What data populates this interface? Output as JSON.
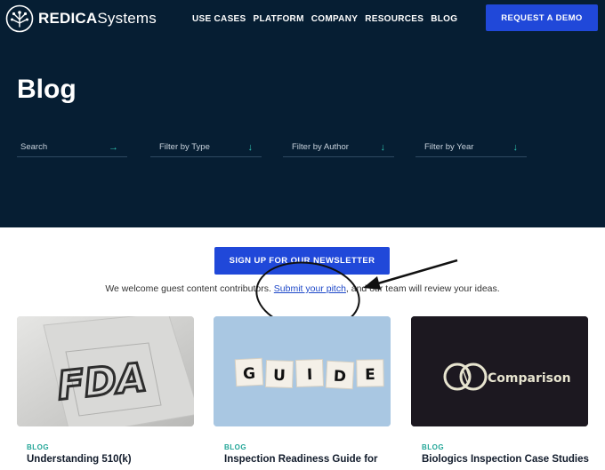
{
  "brand": {
    "name_bold": "REDICA",
    "name_regular": "Systems"
  },
  "nav": {
    "items": [
      "USE CASES",
      "PLATFORM",
      "COMPANY",
      "RESOURCES",
      "BLOG"
    ],
    "cta": "REQUEST A DEMO"
  },
  "hero": {
    "title": "Blog",
    "search_label": "Search",
    "filters": [
      "Filter by Type",
      "Filter by Author",
      "Filter by Year"
    ]
  },
  "newsletter": {
    "button": "SIGN UP FOR OUR NEWSLETTER",
    "text_before": "We welcome guest content contributors. ",
    "link": "Submit your pitch",
    "text_after": ", and our team will review your ideas."
  },
  "cards": [
    {
      "tag": "BLOG",
      "title": "Understanding 510(k)",
      "image_text": "FDA"
    },
    {
      "tag": "BLOG",
      "title": "Inspection Readiness Guide for",
      "image_text": [
        "G",
        "U",
        "I",
        "D",
        "E"
      ]
    },
    {
      "tag": "BLOG",
      "title": "Biologics Inspection Case Studies",
      "image_text": "Comparison"
    }
  ],
  "colors": {
    "hero_bg": "#061e33",
    "accent_blue": "#2048d9",
    "accent_teal": "#2fc4b2"
  }
}
